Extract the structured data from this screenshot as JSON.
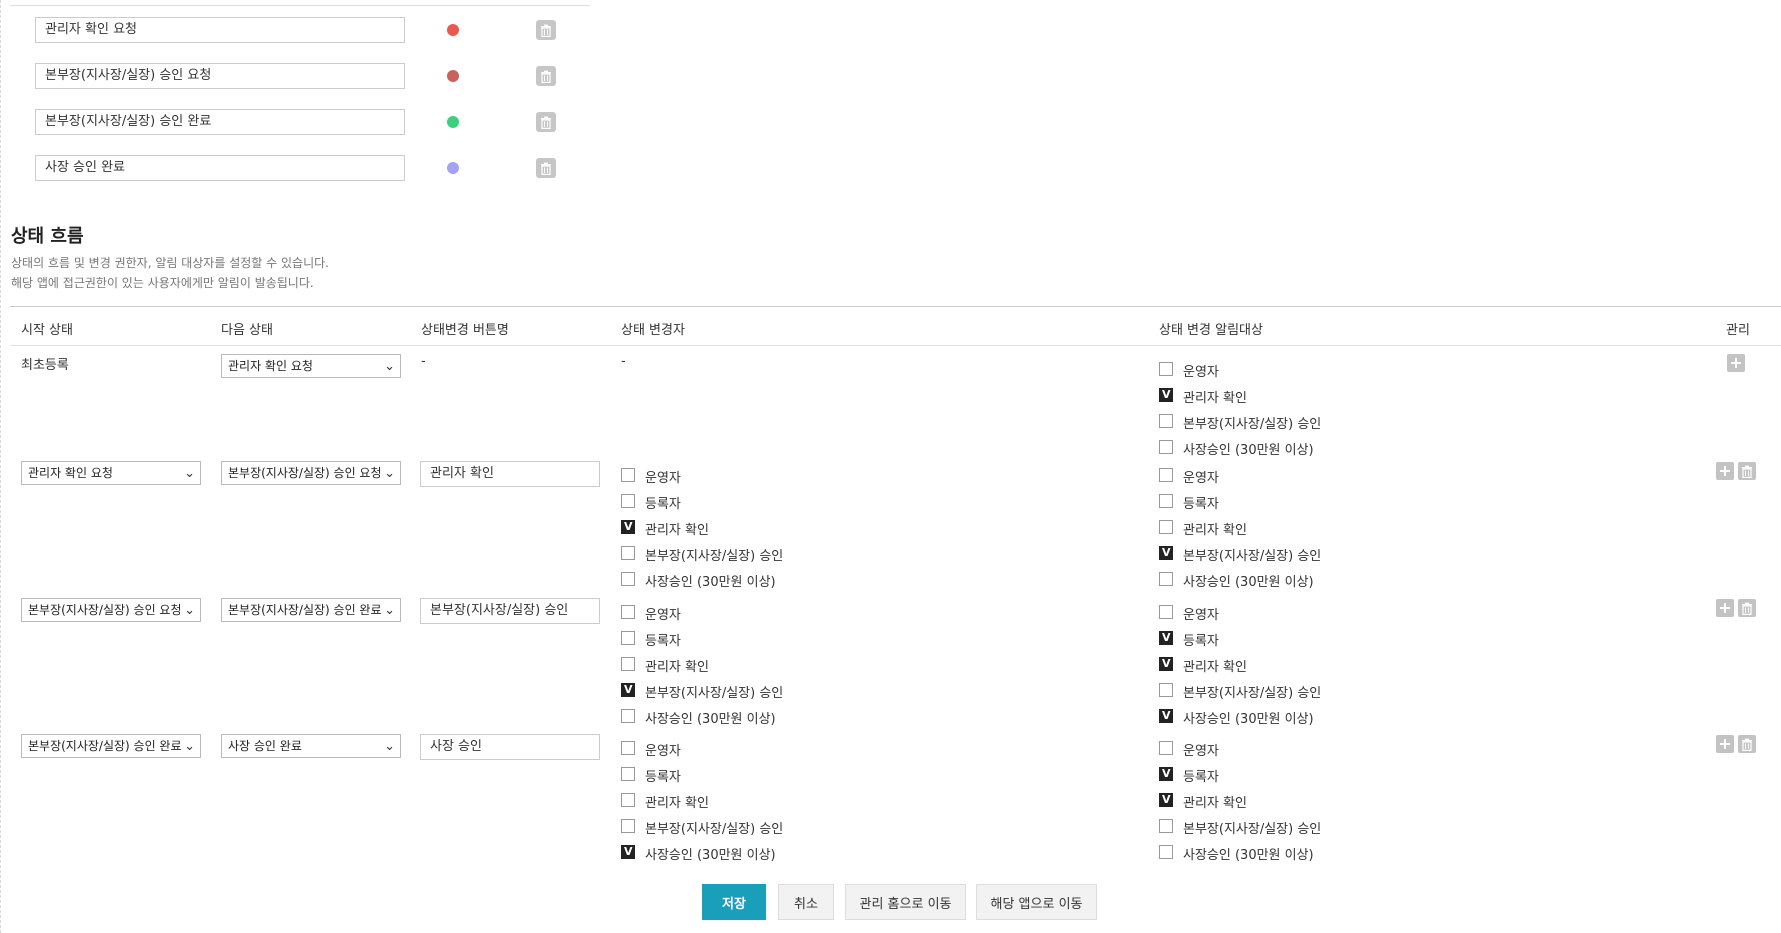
{
  "statuses": [
    {
      "name": "관리자 확인 요청",
      "color": "#e85a4f"
    },
    {
      "name": "본부장(지사장/실장) 승인 요청",
      "color": "#c9625a"
    },
    {
      "name": "본부장(지사장/실장) 승인 완료",
      "color": "#3ad07d"
    },
    {
      "name": "사장 승인 완료",
      "color": "#a3a3f5"
    }
  ],
  "section": {
    "title": "상태 흐름",
    "desc1": "상태의 흐름 및 변경 권한자, 알림 대상자를 설정할 수 있습니다.",
    "desc2": "해당 앱에 접근권한이 있는 사용자에게만 알림이 발송됩니다."
  },
  "table": {
    "headers": {
      "start": "시작 상태",
      "next": "다음 상태",
      "button": "상태변경 버튼명",
      "changer": "상태 변경자",
      "notify": "상태 변경 알림대상",
      "manage": "관리"
    }
  },
  "flows": [
    {
      "start": "최초등록",
      "next": "관리자 확인 요청",
      "button": "-",
      "changer_text": "-",
      "notify": [
        {
          "label": "운영자",
          "checked": false
        },
        {
          "label": "관리자 확인",
          "checked": true
        },
        {
          "label": "본부장(지사장/실장) 승인",
          "checked": false
        },
        {
          "label": "사장승인 (30만원 이상)",
          "checked": false
        }
      ]
    },
    {
      "start": "관리자 확인 요청",
      "next": "본부장(지사장/실장) 승인 요청",
      "button": "관리자 확인",
      "changers": [
        {
          "label": "운영자",
          "checked": false
        },
        {
          "label": "등록자",
          "checked": false
        },
        {
          "label": "관리자 확인",
          "checked": true
        },
        {
          "label": "본부장(지사장/실장) 승인",
          "checked": false
        },
        {
          "label": "사장승인 (30만원 이상)",
          "checked": false
        }
      ],
      "notify": [
        {
          "label": "운영자",
          "checked": false
        },
        {
          "label": "등록자",
          "checked": false
        },
        {
          "label": "관리자 확인",
          "checked": false
        },
        {
          "label": "본부장(지사장/실장) 승인",
          "checked": true
        },
        {
          "label": "사장승인 (30만원 이상)",
          "checked": false
        }
      ]
    },
    {
      "start": "본부장(지사장/실장) 승인 요청",
      "next": "본부장(지사장/실장) 승인 완료",
      "button": "본부장(지사장/실장) 승인",
      "changers": [
        {
          "label": "운영자",
          "checked": false
        },
        {
          "label": "등록자",
          "checked": false
        },
        {
          "label": "관리자 확인",
          "checked": false
        },
        {
          "label": "본부장(지사장/실장) 승인",
          "checked": true
        },
        {
          "label": "사장승인 (30만원 이상)",
          "checked": false
        }
      ],
      "notify": [
        {
          "label": "운영자",
          "checked": false
        },
        {
          "label": "등록자",
          "checked": true
        },
        {
          "label": "관리자 확인",
          "checked": true
        },
        {
          "label": "본부장(지사장/실장) 승인",
          "checked": false
        },
        {
          "label": "사장승인 (30만원 이상)",
          "checked": true
        }
      ]
    },
    {
      "start": "본부장(지사장/실장) 승인 완료",
      "next": "사장 승인 완료",
      "button": "사장 승인",
      "changers": [
        {
          "label": "운영자",
          "checked": false
        },
        {
          "label": "등록자",
          "checked": false
        },
        {
          "label": "관리자 확인",
          "checked": false
        },
        {
          "label": "본부장(지사장/실장) 승인",
          "checked": false
        },
        {
          "label": "사장승인 (30만원 이상)",
          "checked": true
        }
      ],
      "notify": [
        {
          "label": "운영자",
          "checked": false
        },
        {
          "label": "등록자",
          "checked": true
        },
        {
          "label": "관리자 확인",
          "checked": true
        },
        {
          "label": "본부장(지사장/실장) 승인",
          "checked": false
        },
        {
          "label": "사장승인 (30만원 이상)",
          "checked": false
        }
      ]
    }
  ],
  "footer": {
    "save": "저장",
    "cancel": "취소",
    "admin_home": "관리 홈으로 이동",
    "go_app": "해당 앱으로 이동"
  },
  "colors": {
    "primary": "#1a9fba"
  }
}
